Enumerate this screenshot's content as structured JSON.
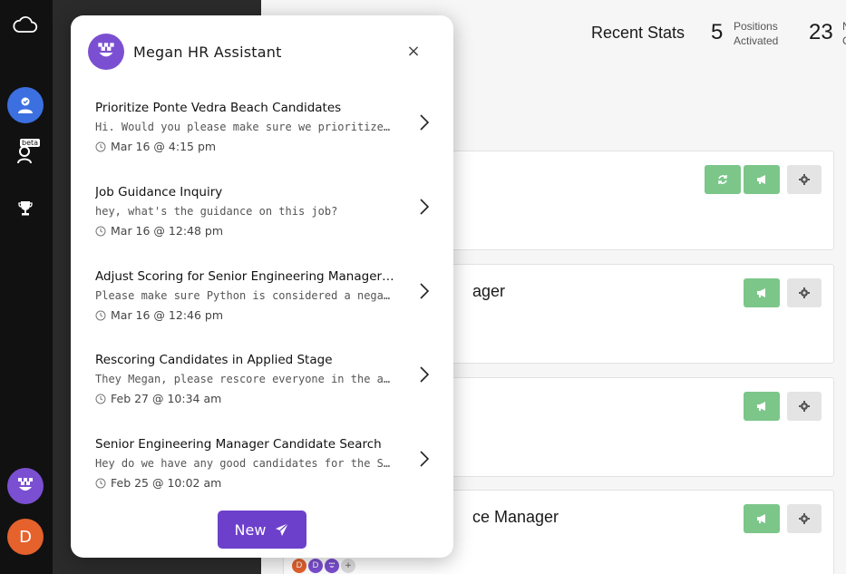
{
  "popup": {
    "title": "Megan HR Assistant",
    "close": "×",
    "new_label": "New",
    "conversations": [
      {
        "title": "Prioritize Ponte Vedra Beach Candidates",
        "preview": "Hi. Would you please make sure we prioritize peopl…",
        "time": "Mar 16 @ 4:15 pm"
      },
      {
        "title": "Job Guidance Inquiry",
        "preview": "hey, what's the guidance on this job?",
        "time": "Mar 16 @ 12:48 pm"
      },
      {
        "title": "Adjust Scoring for Senior Engineering Manager…",
        "preview": "Please make sure Python is considered a negative i…",
        "time": "Mar 16 @ 12:46 pm"
      },
      {
        "title": "Rescoring Candidates in Applied Stage",
        "preview": "They Megan, please rescore everyone in the applie…",
        "time": "Feb 27 @ 10:34 am"
      },
      {
        "title": "Senior Engineering Manager Candidate Search",
        "preview": "Hey do we have any good candidates for the Senior…",
        "time": "Feb 25 @ 10:02 am"
      }
    ]
  },
  "stats": {
    "title": "Recent Stats",
    "items": [
      {
        "value": "5",
        "label_line1": "Positions",
        "label_line2": "Activated"
      },
      {
        "value": "23",
        "label_line1": "N",
        "label_line2": "C"
      }
    ]
  },
  "cards": [
    {
      "title": ""
    },
    {
      "title": "ager"
    },
    {
      "title": ""
    },
    {
      "title": "ce Manager"
    }
  ],
  "rail": {
    "beta": "beta",
    "user_initial": "D"
  },
  "avatars": [
    "D",
    "D",
    "+"
  ],
  "colors": {
    "accent": "#6d40cc",
    "green": "#7cc68a",
    "rail": "#111111"
  }
}
